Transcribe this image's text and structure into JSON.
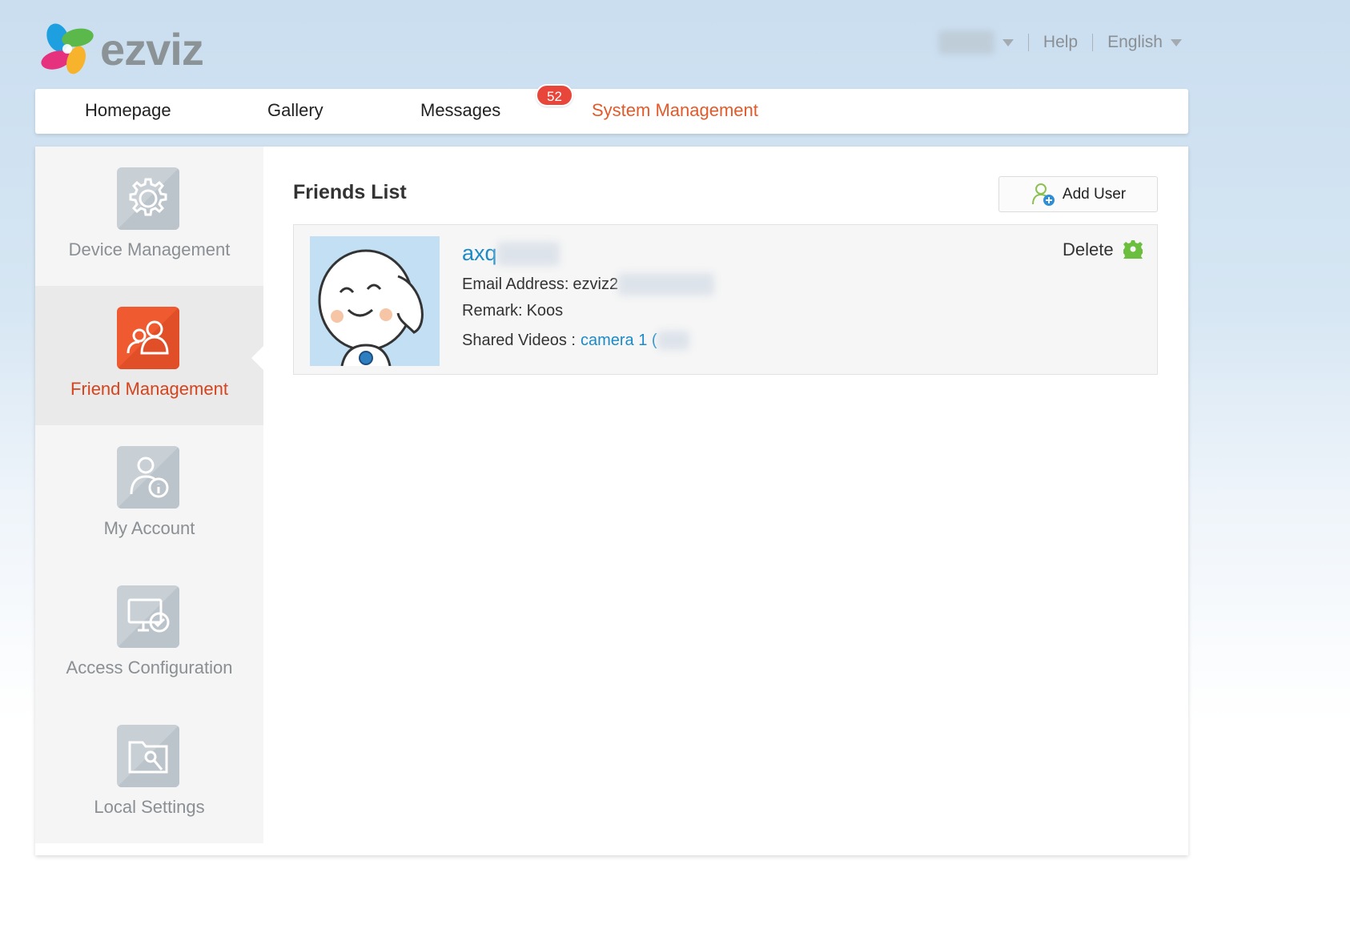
{
  "brand": {
    "name": "ezviz"
  },
  "header": {
    "help": "Help",
    "language": "English"
  },
  "nav": {
    "items": [
      {
        "label": "Homepage"
      },
      {
        "label": "Gallery"
      },
      {
        "label": "Messages",
        "badge": "52"
      },
      {
        "label": "System Management",
        "active": true
      }
    ]
  },
  "sidebar": {
    "items": [
      {
        "label": "Device Management",
        "icon": "gear-icon"
      },
      {
        "label": "Friend Management",
        "icon": "friends-icon",
        "active": true
      },
      {
        "label": "My Account",
        "icon": "account-info-icon"
      },
      {
        "label": "Access Configuration",
        "icon": "monitor-check-icon"
      },
      {
        "label": "Local Settings",
        "icon": "folder-wrench-icon"
      }
    ]
  },
  "main": {
    "title": "Friends List",
    "add_user_label": "Add User",
    "friend": {
      "name": "axq",
      "email_label": "Email Address:",
      "email_value": "ezviz2",
      "remark_label": "Remark:",
      "remark_value": "Koos",
      "shared_label": "Shared Videos :",
      "shared_value": "camera 1 (",
      "delete_label": "Delete"
    }
  },
  "colors": {
    "accent": "#e35a2a",
    "link": "#1b8ac7",
    "badge": "#e8463a",
    "settings_green": "#6cbf3e"
  }
}
